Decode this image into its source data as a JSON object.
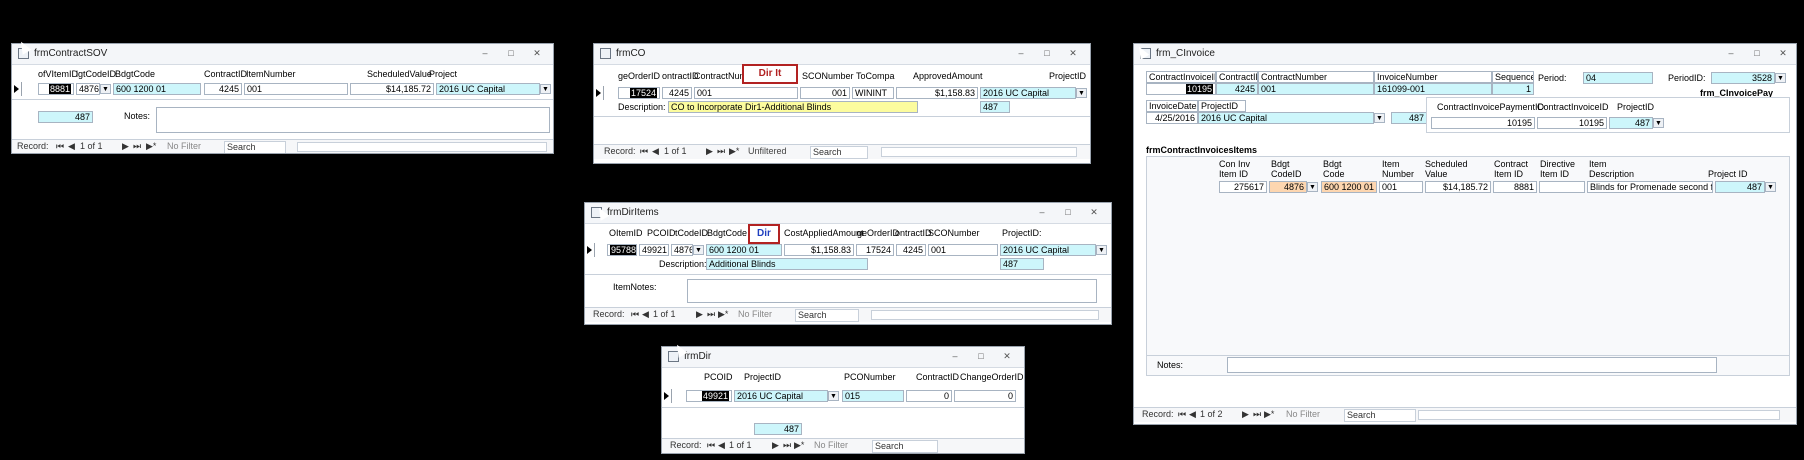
{
  "window_controls": {
    "min": "–",
    "max": "□",
    "close": "✕"
  },
  "nav_common": {
    "first": "⏮",
    "prev": "◀",
    "next": "▶",
    "last": "⏭",
    "new": "▶*"
  },
  "sov": {
    "title": "frmContractSOV",
    "headers": [
      "ofVItemID",
      "lgtCodeID",
      "BdgtCode",
      "ContractID",
      "ItemNumber",
      "ScheduledValue",
      "Project"
    ],
    "row": {
      "item_id": "8881",
      "code_id": "4876",
      "bdgt_code": "600 1200  01",
      "contract_id": "4245",
      "item_number": "001",
      "scheduled_value": "$14,185.72",
      "project": "2016 UC Capital"
    },
    "project_id": "487",
    "notes_label": "Notes:",
    "nav": {
      "record_label": "Record:",
      "position": "1 of 1",
      "filter": "No Filter",
      "search": "Search"
    }
  },
  "co": {
    "title": "frmCO",
    "headers": [
      "geOrderID",
      "ontractID",
      "ContractNum",
      "SCONumber",
      "ToCompa",
      "ApprovedAmount",
      "ProjectID"
    ],
    "button": "Dir It",
    "row": {
      "order_id": "17524",
      "contract_id": "4245",
      "contract_num": "001",
      "sco_number": "001",
      "to_company": "WININT",
      "approved_amount": "$1,158.83",
      "project": "2016 UC Capital"
    },
    "description_label": "Description:",
    "description": "CO to Incorporate Dir1-Additional Blinds",
    "project_id": "487",
    "nav": {
      "record_label": "Record:",
      "position": "1 of 1",
      "filter": "Unfiltered",
      "search": "Search"
    }
  },
  "dir_items": {
    "title": "frmDirItems",
    "headers": [
      "OItemID",
      "PCOID",
      "tCodeID",
      "BdgtCode",
      "CostAppliedAmount",
      "geOrderID",
      "ontractID",
      "SCONumber",
      "ProjectID:"
    ],
    "button": "Dir",
    "row": {
      "item_id": "95788",
      "pco_id": "49921",
      "code_id": "4876",
      "bdgt_code": "600 1200  01",
      "cost_applied": "$1,158.83",
      "order_id": "17524",
      "contract_id": "4245",
      "sco_number": "001",
      "project": "2016 UC Capital"
    },
    "description_label": "Description:",
    "description": "Additional Blinds",
    "project_id": "487",
    "item_notes_label": "ItemNotes:",
    "nav": {
      "record_label": "Record:",
      "position": "1 of 1",
      "filter": "No Filter",
      "search": "Search"
    }
  },
  "dir": {
    "title": "frmDir",
    "headers": [
      "PCOID",
      "ProjectID",
      "PCONumber",
      "ContractID",
      "ChangeOrderID"
    ],
    "row": {
      "pco_id": "49921",
      "project": "2016 UC Capital",
      "pco_number": "015",
      "contract_id": "0",
      "change_order_id": "0"
    },
    "project_id": "487",
    "nav": {
      "record_label": "Record:",
      "position": "1 of 1",
      "filter": "No Filter",
      "search": "Search"
    }
  },
  "cinvoice": {
    "title": "frm_CInvoice",
    "top_headers": [
      "ContractInvoiceID",
      "ContractID",
      "ContractNumber",
      "InvoiceNumber",
      "Sequence"
    ],
    "top_row": {
      "invoice_id": "10195",
      "contract_id": "4245",
      "contract_number": "001",
      "invoice_number": "161099-001",
      "sequence": "1"
    },
    "period_label": "Period:",
    "period": "04",
    "period_id_label": "PeriodID:",
    "period_id": "3528",
    "subform_title": "frm_CInvoicePay",
    "date_label": "InvoiceDate",
    "project_label": "ProjectID",
    "invoice_date": "4/25/2016",
    "project": "2016 UC Capital",
    "project_id": "487",
    "pay_headers": [
      "ContractInvoicePaymentID",
      "ContractInvoiceID",
      "ProjectID"
    ],
    "pay_row": {
      "payment_id": "10195",
      "invoice_id": "10195",
      "project_id": "487"
    },
    "items_title": "frmContractInvoicesItems",
    "items_headers": [
      "Con Inv Item ID",
      "Bdgt CodeID",
      "Bdgt Code",
      "Item Number",
      "Scheduled Value",
      "Contract Item ID",
      "Directive Item ID",
      "Item Description",
      "Project ID"
    ],
    "items_row": {
      "item_id": "275617",
      "code_id": "4876",
      "bdgt_code": "600 1200  01",
      "item_number": "001",
      "scheduled_value": "$14,185.72",
      "contract_item_id": "8881",
      "directive_item_id": "",
      "description": "Blinds for Promenade second floor",
      "project_id": "487"
    },
    "notes_label": "Notes:",
    "nav": {
      "record_label": "Record:",
      "position": "1 of 2",
      "filter": "No Filter",
      "search": "Search"
    }
  }
}
